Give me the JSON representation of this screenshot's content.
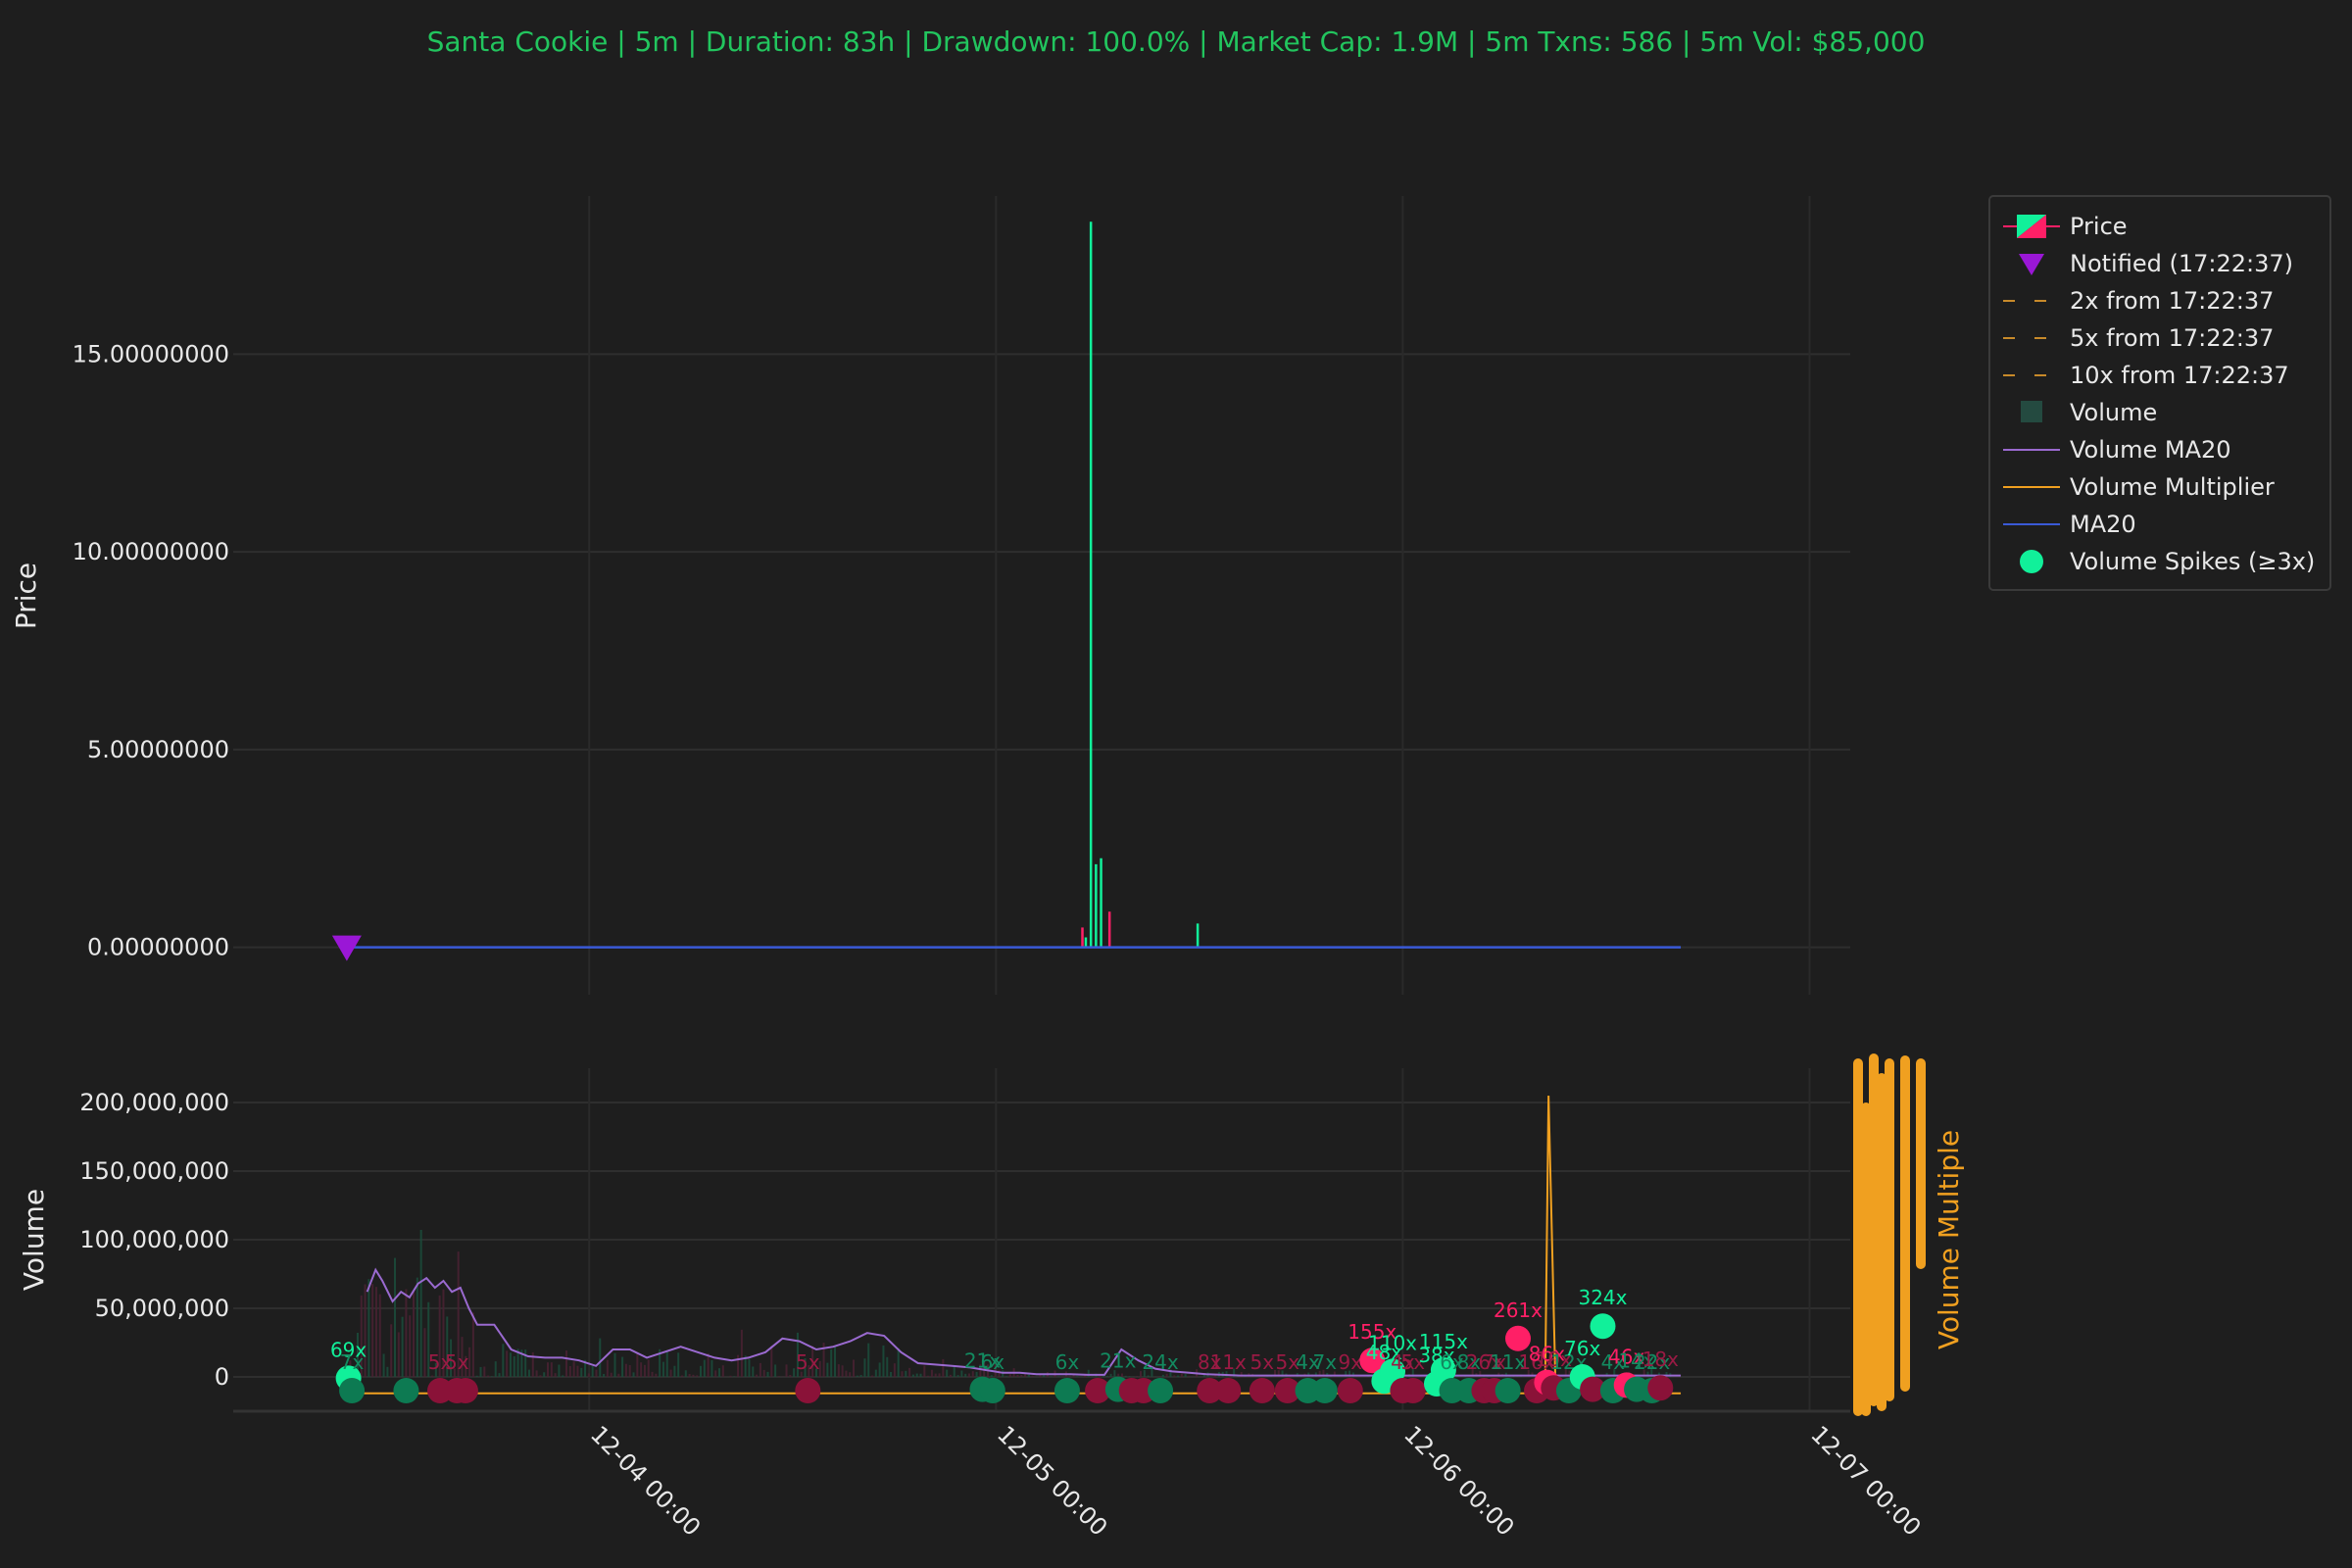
{
  "chart_data": {
    "type": "candlestick_volume",
    "title": "Santa Cookie | 5m | Duration: 83h | Drawdown: 100.0% | Market Cap: 1.9M | 5m Txns: 586 | 5m Vol: $85,000",
    "colors": {
      "background": "#1e1e1e",
      "title": "#22c55e",
      "up": "#11f09a",
      "down": "#ff1f66",
      "notified": "#9a17d6",
      "ma20": "#3a5ad6",
      "volume_ma20": "#9a6ad0",
      "volume_multiplier": "#f0a020",
      "target_lines": "#c88a2a"
    },
    "price_panel": {
      "ylabel": "Price",
      "ylim": [
        -1.2,
        19.0
      ],
      "yticks": [
        0,
        5,
        10,
        15
      ],
      "ytick_labels": [
        "0.00000000",
        "5.00000000",
        "10.00000000",
        "15.00000000"
      ],
      "candles": [
        {
          "t": 43.7,
          "high": 0.5,
          "low": 0.0,
          "dir": "down"
        },
        {
          "t": 43.9,
          "high": 0.25,
          "low": 0.0,
          "dir": "up"
        },
        {
          "t": 44.2,
          "high": 18.35,
          "low": 0.0,
          "dir": "up"
        },
        {
          "t": 44.5,
          "high": 2.1,
          "low": 0.0,
          "dir": "up"
        },
        {
          "t": 44.8,
          "high": 2.25,
          "low": 0.0,
          "dir": "up"
        },
        {
          "t": 45.3,
          "high": 0.9,
          "low": 0.0,
          "dir": "down"
        },
        {
          "t": 50.5,
          "high": 0.6,
          "low": 0.0,
          "dir": "up"
        }
      ],
      "ma20": {
        "x": [
          0.3,
          79.0
        ],
        "y": [
          0.0,
          0.0
        ]
      },
      "notified": {
        "t": 0.3,
        "price": 0.0,
        "label": "Notified (17:22:37)"
      }
    },
    "volume_panel": {
      "ylabel": "Volume",
      "y2label": "Volume Multiple",
      "ylim": [
        -25000000,
        225000000
      ],
      "yticks": [
        0,
        50000000,
        100000000,
        150000000,
        200000000
      ],
      "ytick_labels": [
        "0",
        "50,000,000",
        "100,000,000",
        "150,000,000",
        "200,000,000"
      ],
      "volume_ma20": {
        "x": [
          1.5,
          2.0,
          2.4,
          3.0,
          3.5,
          4.0,
          4.5,
          5.0,
          5.5,
          6.0,
          6.5,
          7.0,
          7.5,
          8.0,
          9.0,
          10.0,
          11.0,
          12.0,
          13.0,
          14.0,
          15.0,
          16.0,
          17.0,
          18.0,
          19.0,
          20.0,
          21.0,
          22.0,
          23.0,
          24.0,
          25.0,
          26.0,
          27.0,
          28.0,
          29.0,
          30.0,
          31.0,
          32.0,
          33.0,
          34.0,
          35.0,
          36.0,
          37.0,
          38.0,
          39.0,
          40.0,
          41.0,
          42.0,
          43.0,
          44.0,
          45.0,
          46.0,
          47.0,
          48.0,
          49.0,
          50.0,
          51.0,
          52.0,
          53.0,
          55.0,
          58.0,
          62.0,
          66.0,
          70.0,
          74.0,
          77.0,
          79.0
        ],
        "y": [
          62000000,
          78000000,
          70000000,
          55000000,
          62000000,
          58000000,
          68000000,
          72000000,
          65000000,
          70000000,
          62000000,
          65000000,
          50000000,
          38000000,
          38000000,
          20000000,
          15000000,
          14000000,
          14000000,
          12000000,
          8000000,
          20000000,
          20000000,
          14000000,
          18000000,
          22000000,
          18000000,
          14000000,
          12000000,
          14000000,
          18000000,
          28000000,
          26000000,
          20000000,
          22000000,
          26000000,
          32000000,
          30000000,
          18000000,
          10000000,
          9000000,
          8000000,
          7000000,
          5000000,
          3000000,
          3000000,
          2000000,
          2000000,
          2000000,
          1500000,
          1500000,
          20000000,
          12000000,
          6000000,
          4000000,
          3000000,
          2000000,
          1500000,
          1000000,
          1000000,
          1000000,
          1000000,
          1000000,
          1000000,
          1000000,
          1000000,
          1000000
        ]
      },
      "volume_multiplier": {
        "x": [
          0.3,
          70.0,
          71.0,
          71.2,
          71.6,
          72.2,
          73.0,
          74.0,
          79.0
        ],
        "y": [
          -12000000,
          -12000000,
          -6000000,
          205000000,
          0,
          -8000000,
          -10000000,
          -12000000,
          -12000000
        ]
      },
      "spikes": [
        {
          "t": 0.4,
          "v": -1000000,
          "dir": "up",
          "label": "69x"
        },
        {
          "t": 0.6,
          "v": -10000000,
          "dir": "up",
          "label": "7x"
        },
        {
          "t": 3.8,
          "v": -10000000,
          "dir": "up",
          "label": ""
        },
        {
          "t": 5.8,
          "v": -10000000,
          "dir": "down",
          "label": "5x"
        },
        {
          "t": 6.8,
          "v": -10000000,
          "dir": "down",
          "label": "5x"
        },
        {
          "t": 7.3,
          "v": -10000000,
          "dir": "down",
          "label": ""
        },
        {
          "t": 27.5,
          "v": -10000000,
          "dir": "down",
          "label": "5x"
        },
        {
          "t": 37.8,
          "v": -9000000,
          "dir": "up",
          "label": "21x"
        },
        {
          "t": 38.4,
          "v": -10000000,
          "dir": "up",
          "label": "6x"
        },
        {
          "t": 42.8,
          "v": -10000000,
          "dir": "up",
          "label": "6x"
        },
        {
          "t": 44.6,
          "v": -10000000,
          "dir": "down",
          "label": ""
        },
        {
          "t": 45.8,
          "v": -9000000,
          "dir": "up",
          "label": "21x"
        },
        {
          "t": 46.6,
          "v": -10000000,
          "dir": "down",
          "label": ""
        },
        {
          "t": 47.3,
          "v": -10000000,
          "dir": "down",
          "label": ""
        },
        {
          "t": 48.3,
          "v": -10000000,
          "dir": "up",
          "label": "24x"
        },
        {
          "t": 51.2,
          "v": -10000000,
          "dir": "down",
          "label": "8x"
        },
        {
          "t": 52.3,
          "v": -10000000,
          "dir": "down",
          "label": "11x"
        },
        {
          "t": 54.3,
          "v": -10000000,
          "dir": "down",
          "label": "5x"
        },
        {
          "t": 55.8,
          "v": -10000000,
          "dir": "down",
          "label": "5x"
        },
        {
          "t": 57.0,
          "v": -10000000,
          "dir": "up",
          "label": "4x"
        },
        {
          "t": 58.0,
          "v": -10000000,
          "dir": "up",
          "label": "7x"
        },
        {
          "t": 59.5,
          "v": -10000000,
          "dir": "down",
          "label": "9x"
        },
        {
          "t": 60.8,
          "v": 12000000,
          "dir": "down",
          "label": "155x"
        },
        {
          "t": 61.5,
          "v": -3000000,
          "dir": "up",
          "label": "48x"
        },
        {
          "t": 62.0,
          "v": 4000000,
          "dir": "up",
          "label": "110x"
        },
        {
          "t": 62.6,
          "v": -10000000,
          "dir": "down",
          "label": "4x"
        },
        {
          "t": 63.2,
          "v": -10000000,
          "dir": "down",
          "label": "5x"
        },
        {
          "t": 64.6,
          "v": -5000000,
          "dir": "up",
          "label": "38x"
        },
        {
          "t": 65.0,
          "v": 5000000,
          "dir": "up",
          "label": "115x"
        },
        {
          "t": 65.5,
          "v": -10000000,
          "dir": "up",
          "label": "6x"
        },
        {
          "t": 66.5,
          "v": -10000000,
          "dir": "up",
          "label": "8x"
        },
        {
          "t": 67.4,
          "v": -10000000,
          "dir": "down",
          "label": "26x"
        },
        {
          "t": 68.0,
          "v": -10000000,
          "dir": "down",
          "label": "7x"
        },
        {
          "t": 68.8,
          "v": -10000000,
          "dir": "up",
          "label": "11x"
        },
        {
          "t": 69.4,
          "v": 28000000,
          "dir": "down",
          "label": "261x"
        },
        {
          "t": 70.5,
          "v": -10000000,
          "dir": "down",
          "label": "16x"
        },
        {
          "t": 71.1,
          "v": -4000000,
          "dir": "down",
          "label": "86x"
        },
        {
          "t": 71.5,
          "v": -8000000,
          "dir": "down",
          "label": "10x"
        },
        {
          "t": 72.4,
          "v": -10000000,
          "dir": "up",
          "label": "12x"
        },
        {
          "t": 73.2,
          "v": 0,
          "dir": "up",
          "label": "76x"
        },
        {
          "t": 73.8,
          "v": -9000000,
          "dir": "down",
          "label": ""
        },
        {
          "t": 74.4,
          "v": 37000000,
          "dir": "up",
          "label": "324x"
        },
        {
          "t": 75.0,
          "v": -10000000,
          "dir": "up",
          "label": "4x"
        },
        {
          "t": 75.8,
          "v": -6000000,
          "dir": "down",
          "label": "46x"
        },
        {
          "t": 76.4,
          "v": -9000000,
          "dir": "up",
          "label": "14x"
        },
        {
          "t": 77.3,
          "v": -10000000,
          "dir": "up",
          "label": "22x"
        },
        {
          "t": 77.8,
          "v": -8000000,
          "dir": "down",
          "label": "18x"
        }
      ]
    },
    "x_axis": {
      "tick_t": [
        14.6,
        38.6,
        62.6,
        86.6
      ],
      "tick_labels": [
        "12-04 00:00",
        "12-05 00:00",
        "12-06 00:00",
        "12-07 00:00"
      ]
    },
    "legend": {
      "placement": "top-right, outside plot",
      "entries": [
        {
          "key": "price",
          "label": "Price"
        },
        {
          "key": "notified",
          "label": "Notified (17:22:37)"
        },
        {
          "key": "t2",
          "label": "2x from 17:22:37"
        },
        {
          "key": "t5",
          "label": "5x from 17:22:37"
        },
        {
          "key": "t10",
          "label": "10x from 17:22:37"
        },
        {
          "key": "volume",
          "label": "Volume"
        },
        {
          "key": "vma20",
          "label": "Volume MA20"
        },
        {
          "key": "vmult",
          "label": "Volume Multiplier"
        },
        {
          "key": "ma20",
          "label": "MA20"
        },
        {
          "key": "spikes",
          "label": "Volume Spikes (≥3x)"
        }
      ]
    }
  }
}
